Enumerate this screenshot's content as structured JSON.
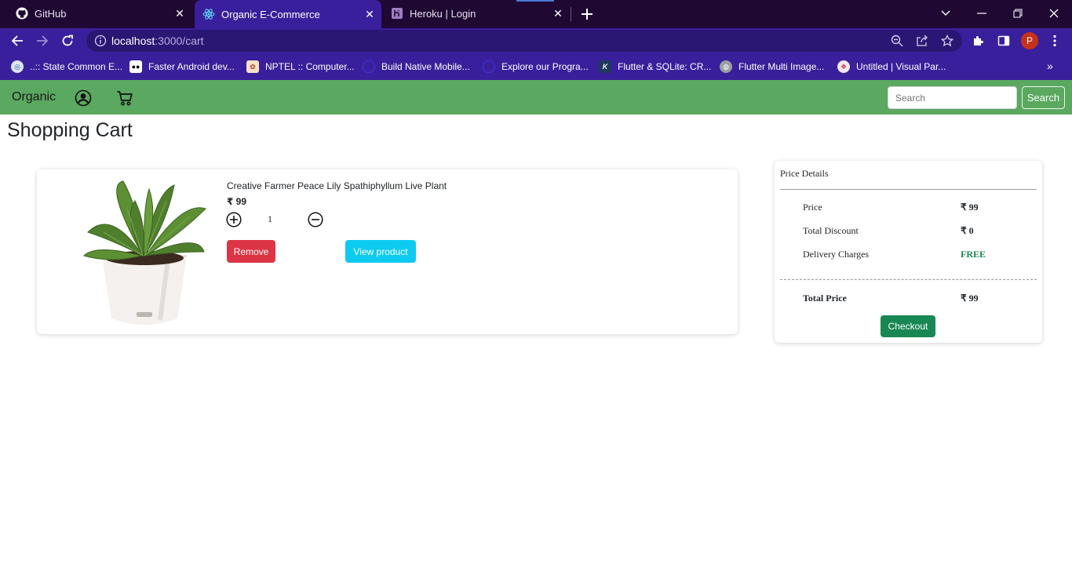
{
  "browser": {
    "tabs": [
      {
        "title": "GitHub",
        "icon": "github-icon"
      },
      {
        "title": "Organic E-Commerce",
        "icon": "react-icon"
      },
      {
        "title": "Heroku | Login",
        "icon": "heroku-icon"
      }
    ],
    "url_host": "localhost",
    "url_path": ":3000/cart",
    "profile_initial": "P",
    "bookmarks": [
      {
        "label": "..:: State Common E...",
        "icon": "globe-icon"
      },
      {
        "label": "Faster Android dev...",
        "icon": "medium-icon"
      },
      {
        "label": "NPTEL :: Computer...",
        "icon": "nptel-icon"
      },
      {
        "label": "Build Native Mobile...",
        "icon": "bookmark-icon"
      },
      {
        "label": "Explore our Progra...",
        "icon": "bookmark-icon"
      },
      {
        "label": "Flutter & SQLite: CR...",
        "icon": "k-icon"
      },
      {
        "label": "Flutter Multi Image...",
        "icon": "globe-icon"
      },
      {
        "label": "Untitled | Visual Par...",
        "icon": "visual-paradigm-icon"
      }
    ]
  },
  "navbar": {
    "brand": "Organic",
    "search_placeholder": "Search",
    "search_button": "Search"
  },
  "page": {
    "title": "Shopping Cart"
  },
  "cart": {
    "items": [
      {
        "name": "Creative Farmer Peace Lily Spathiphyllum Live Plant",
        "price": "₹ 99",
        "quantity": "1",
        "remove_label": "Remove",
        "view_label": "View product"
      }
    ]
  },
  "price_details": {
    "title": "Price Details",
    "rows": [
      {
        "label": "Price",
        "value": "₹ 99"
      },
      {
        "label": "Total Discount",
        "value": "₹ 0"
      },
      {
        "label": "Delivery Charges",
        "value": "FREE"
      }
    ],
    "total_label": "Total Price",
    "total_value": "₹ 99",
    "checkout_label": "Checkout"
  },
  "colors": {
    "navbar": "#5ba860",
    "remove": "#dc3545",
    "view": "#0dcaf0",
    "checkout": "#198754",
    "free": "#198754",
    "chrome_frame": "#3a1f9c"
  }
}
